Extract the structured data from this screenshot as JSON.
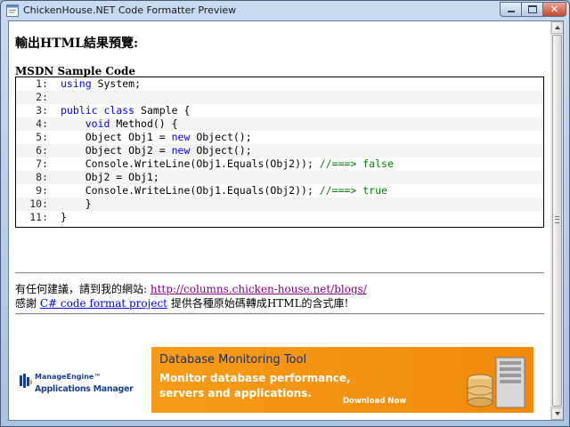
{
  "window": {
    "title": "ChickenHouse.NET Code Formatter Preview",
    "controls": {
      "minimize": "minimize",
      "maximize": "maximize",
      "close": "✕"
    }
  },
  "page": {
    "heading": "輸出HTML結果預覽:",
    "code_caption": "MSDN Sample Code"
  },
  "code": {
    "lines": [
      {
        "num": "1:",
        "text": "using System;"
      },
      {
        "num": "2:",
        "text": ""
      },
      {
        "num": "3:",
        "text": "public class Sample {"
      },
      {
        "num": "4:",
        "text": "    void Method() {"
      },
      {
        "num": "5:",
        "text": "    Object Obj1 = new Object();"
      },
      {
        "num": "6:",
        "text": "    Object Obj2 = new Object();"
      },
      {
        "num": "7:",
        "text": "    Console.WriteLine(Obj1.Equals(Obj2)); //===> false"
      },
      {
        "num": "8:",
        "text": "    Obj2 = Obj1;"
      },
      {
        "num": "9:",
        "text": "    Console.WriteLine(Obj1.Equals(Obj2)); //===> true"
      },
      {
        "num": "10:",
        "text": "    }"
      },
      {
        "num": "11:",
        "text": "}"
      }
    ]
  },
  "info": {
    "line1_prefix": "有任何建議，請到我的網站: ",
    "line1_link": "http://columns.chicken-house.net/blogs/",
    "line2_prefix": "感謝 ",
    "line2_link": "C# code format project",
    "line2_suffix": " 提供各種原始碼轉成HTML的含式庫!"
  },
  "banner": {
    "brand": "ManageEngine™",
    "product": "Applications Manager",
    "title": "Database Monitoring Tool",
    "subtitle": "Monitor database performance, servers and applications.",
    "cta": "Download Now"
  },
  "colors": {
    "keyword": "#0000ff",
    "comment": "#008000",
    "visited_link": "#800080",
    "link": "#0000ff",
    "banner_orange": "#f7a21b"
  }
}
